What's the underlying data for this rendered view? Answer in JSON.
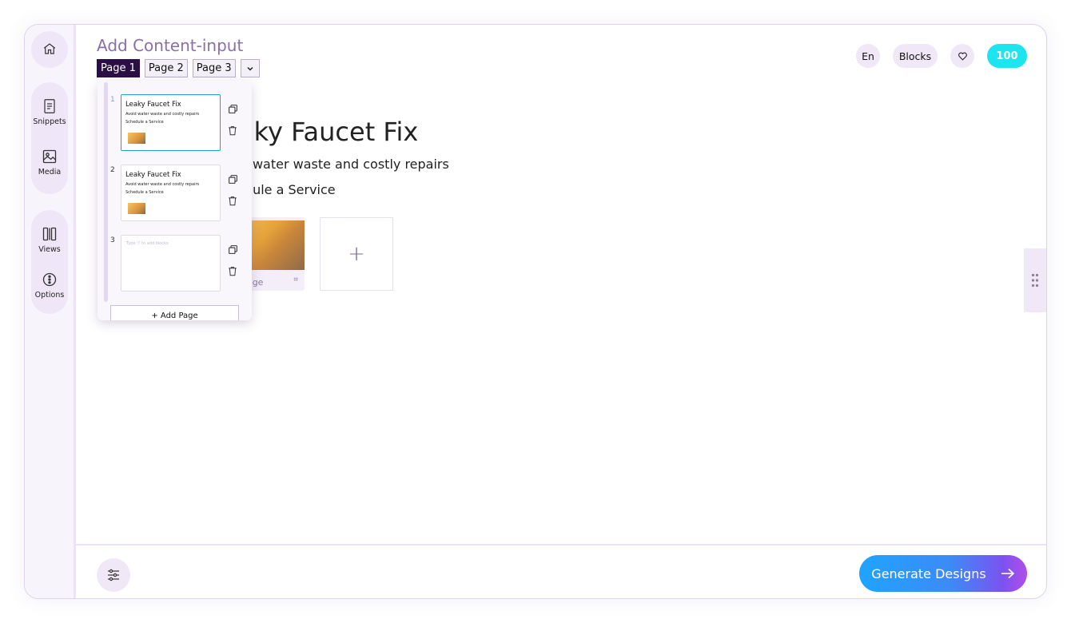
{
  "header": {
    "title": "Add Content-input",
    "tabs": [
      "Page 1",
      "Page 2",
      "Page 3"
    ],
    "language": "En",
    "blocks_label": "Blocks",
    "credits": "100"
  },
  "sidebar": {
    "items": [
      {
        "label": "Snippets",
        "icon": "document-icon"
      },
      {
        "label": "Media",
        "icon": "image-icon"
      },
      {
        "label": "Views",
        "icon": "columns-icon"
      },
      {
        "label": "Options",
        "icon": "options-icon"
      }
    ]
  },
  "preview": {
    "headline": "Leaky Faucet Fix",
    "subtitle": "Avoid water waste and costly repairs",
    "cta": "Schedule a Service",
    "image_caption": "Image"
  },
  "pages_dropdown": {
    "pages": [
      {
        "number": "1",
        "headline": "Leaky Faucet Fix",
        "subtitle": "Avoid water waste and costly repairs",
        "cta": "Schedule a Service"
      },
      {
        "number": "2",
        "headline": "Leaky Faucet Fix",
        "subtitle": "Avoid water waste and costly repairs",
        "cta": "Schedule a Service"
      },
      {
        "number": "3",
        "placeholder": "Type '/' to add blocks"
      }
    ],
    "add_page_label": "+ Add Page"
  },
  "footer": {
    "generate_label": "Generate Designs"
  },
  "colors": {
    "accent": "#2b0f44",
    "credit_badge": "#1de5f0",
    "title": "#8a6fa8",
    "gradient_start": "#1ea4ff",
    "gradient_end": "#b04de9"
  }
}
